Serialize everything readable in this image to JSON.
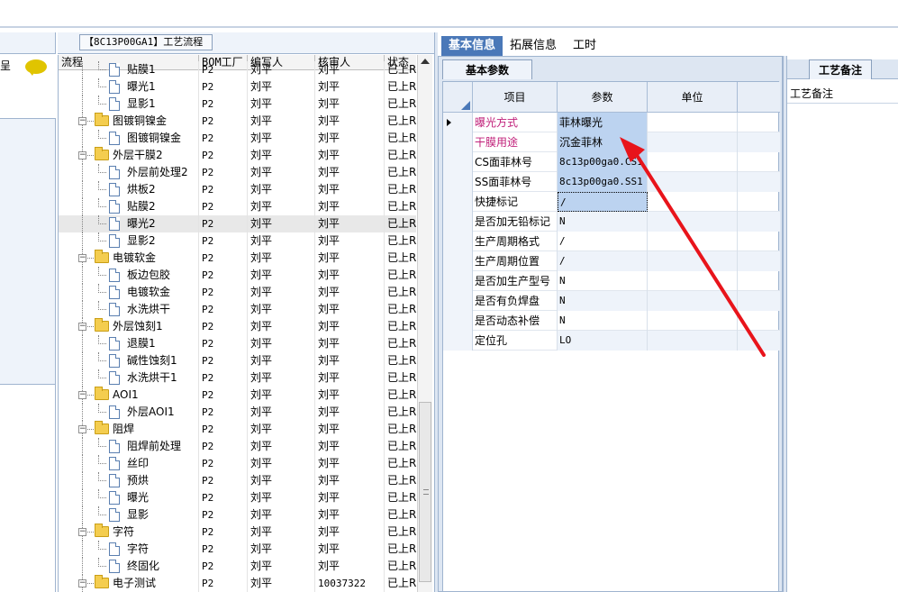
{
  "flow_panel": {
    "tab_title": "【8C13P00GA1】工艺流程",
    "columns": [
      "流程",
      "BOM工厂",
      "编写人",
      "核审人",
      "状态"
    ],
    "rows": [
      {
        "level": 2,
        "type": "doc",
        "label": "贴膜1",
        "bom": "P2",
        "writer": "刘平",
        "reviewer": "刘平",
        "status": "已上R"
      },
      {
        "level": 2,
        "type": "doc",
        "label": "曝光1",
        "bom": "P2",
        "writer": "刘平",
        "reviewer": "刘平",
        "status": "已上R"
      },
      {
        "level": 2,
        "type": "doc",
        "label": "显影1",
        "bom": "P2",
        "writer": "刘平",
        "reviewer": "刘平",
        "status": "已上R"
      },
      {
        "level": 1,
        "type": "folder",
        "label": "图镀铜镍金",
        "bom": "P2",
        "writer": "刘平",
        "reviewer": "刘平",
        "status": "已上R"
      },
      {
        "level": 2,
        "type": "doc",
        "label": "图镀铜镍金",
        "bom": "P2",
        "writer": "刘平",
        "reviewer": "刘平",
        "status": "已上R"
      },
      {
        "level": 1,
        "type": "folder",
        "label": "外层干膜2",
        "bom": "P2",
        "writer": "刘平",
        "reviewer": "刘平",
        "status": "已上R"
      },
      {
        "level": 2,
        "type": "doc",
        "label": "外层前处理2",
        "bom": "P2",
        "writer": "刘平",
        "reviewer": "刘平",
        "status": "已上R"
      },
      {
        "level": 2,
        "type": "doc",
        "label": "烘板2",
        "bom": "P2",
        "writer": "刘平",
        "reviewer": "刘平",
        "status": "已上R"
      },
      {
        "level": 2,
        "type": "doc",
        "label": "贴膜2",
        "bom": "P2",
        "writer": "刘平",
        "reviewer": "刘平",
        "status": "已上R"
      },
      {
        "level": 2,
        "type": "doc",
        "label": "曝光2",
        "bom": "P2",
        "writer": "刘平",
        "reviewer": "刘平",
        "status": "已上R",
        "selected": true
      },
      {
        "level": 2,
        "type": "doc",
        "label": "显影2",
        "bom": "P2",
        "writer": "刘平",
        "reviewer": "刘平",
        "status": "已上R"
      },
      {
        "level": 1,
        "type": "folder",
        "label": "电镀软金",
        "bom": "P2",
        "writer": "刘平",
        "reviewer": "刘平",
        "status": "已上R"
      },
      {
        "level": 2,
        "type": "doc",
        "label": "板边包胶",
        "bom": "P2",
        "writer": "刘平",
        "reviewer": "刘平",
        "status": "已上R"
      },
      {
        "level": 2,
        "type": "doc",
        "label": "电镀软金",
        "bom": "P2",
        "writer": "刘平",
        "reviewer": "刘平",
        "status": "已上R"
      },
      {
        "level": 2,
        "type": "doc",
        "label": "水洗烘干",
        "bom": "P2",
        "writer": "刘平",
        "reviewer": "刘平",
        "status": "已上R"
      },
      {
        "level": 1,
        "type": "folder",
        "label": "外层蚀刻1",
        "bom": "P2",
        "writer": "刘平",
        "reviewer": "刘平",
        "status": "已上R"
      },
      {
        "level": 2,
        "type": "doc",
        "label": "退膜1",
        "bom": "P2",
        "writer": "刘平",
        "reviewer": "刘平",
        "status": "已上R"
      },
      {
        "level": 2,
        "type": "doc",
        "label": "碱性蚀刻1",
        "bom": "P2",
        "writer": "刘平",
        "reviewer": "刘平",
        "status": "已上R"
      },
      {
        "level": 2,
        "type": "doc",
        "label": "水洗烘干1",
        "bom": "P2",
        "writer": "刘平",
        "reviewer": "刘平",
        "status": "已上R"
      },
      {
        "level": 1,
        "type": "folder",
        "label": "AOI1",
        "bom": "P2",
        "writer": "刘平",
        "reviewer": "刘平",
        "status": "已上R"
      },
      {
        "level": 2,
        "type": "doc",
        "label": "外层AOI1",
        "bom": "P2",
        "writer": "刘平",
        "reviewer": "刘平",
        "status": "已上R"
      },
      {
        "level": 1,
        "type": "folder",
        "label": "阻焊",
        "bom": "P2",
        "writer": "刘平",
        "reviewer": "刘平",
        "status": "已上R"
      },
      {
        "level": 2,
        "type": "doc",
        "label": "阻焊前处理",
        "bom": "P2",
        "writer": "刘平",
        "reviewer": "刘平",
        "status": "已上R"
      },
      {
        "level": 2,
        "type": "doc",
        "label": "丝印",
        "bom": "P2",
        "writer": "刘平",
        "reviewer": "刘平",
        "status": "已上R"
      },
      {
        "level": 2,
        "type": "doc",
        "label": "预烘",
        "bom": "P2",
        "writer": "刘平",
        "reviewer": "刘平",
        "status": "已上R"
      },
      {
        "level": 2,
        "type": "doc",
        "label": "曝光",
        "bom": "P2",
        "writer": "刘平",
        "reviewer": "刘平",
        "status": "已上R"
      },
      {
        "level": 2,
        "type": "doc",
        "label": "显影",
        "bom": "P2",
        "writer": "刘平",
        "reviewer": "刘平",
        "status": "已上R"
      },
      {
        "level": 1,
        "type": "folder",
        "label": "字符",
        "bom": "P2",
        "writer": "刘平",
        "reviewer": "刘平",
        "status": "已上R"
      },
      {
        "level": 2,
        "type": "doc",
        "label": "字符",
        "bom": "P2",
        "writer": "刘平",
        "reviewer": "刘平",
        "status": "已上R"
      },
      {
        "level": 2,
        "type": "doc",
        "label": "终固化",
        "bom": "P2",
        "writer": "刘平",
        "reviewer": "刘平",
        "status": "已上R"
      },
      {
        "level": 1,
        "type": "folder",
        "label": "电子测试",
        "bom": "P2",
        "writer": "刘平",
        "reviewer": "10037322",
        "status": "已上R"
      }
    ]
  },
  "left_panel": {
    "header_text": "呈"
  },
  "right_panel": {
    "tabs": [
      "基本信息",
      "拓展信息",
      "工时"
    ],
    "active_tab": 0,
    "subtab": "基本参数",
    "columns": [
      "项目",
      "参数",
      "单位"
    ],
    "params": [
      {
        "item": "曝光方式",
        "value": "菲林曝光",
        "unit": "",
        "item_color": "pink",
        "current": true
      },
      {
        "item": "干膜用途",
        "value": "沉金菲林",
        "unit": "",
        "item_color": "pink"
      },
      {
        "item": "CS面菲林号",
        "value": "8c13p00ga0.CS1",
        "unit": ""
      },
      {
        "item": "SS面菲林号",
        "value": "8c13p00ga0.SS1",
        "unit": ""
      },
      {
        "item": "快捷标记",
        "value": "/",
        "unit": "",
        "focus": true
      },
      {
        "item": "是否加无铅标记",
        "value": "N",
        "unit": ""
      },
      {
        "item": "生产周期格式",
        "value": "/",
        "unit": ""
      },
      {
        "item": "生产周期位置",
        "value": "/",
        "unit": ""
      },
      {
        "item": "是否加生产型号",
        "value": "N",
        "unit": ""
      },
      {
        "item": "是否有负焊盘",
        "value": "N",
        "unit": ""
      },
      {
        "item": "是否动态补偿",
        "value": "N",
        "unit": ""
      },
      {
        "item": "定位孔",
        "value": "LO",
        "unit": ""
      }
    ]
  },
  "memo_panel": {
    "tab": "工艺备注",
    "label": "工艺备注"
  },
  "annotation": {
    "arrow_color": "#e8141b"
  }
}
